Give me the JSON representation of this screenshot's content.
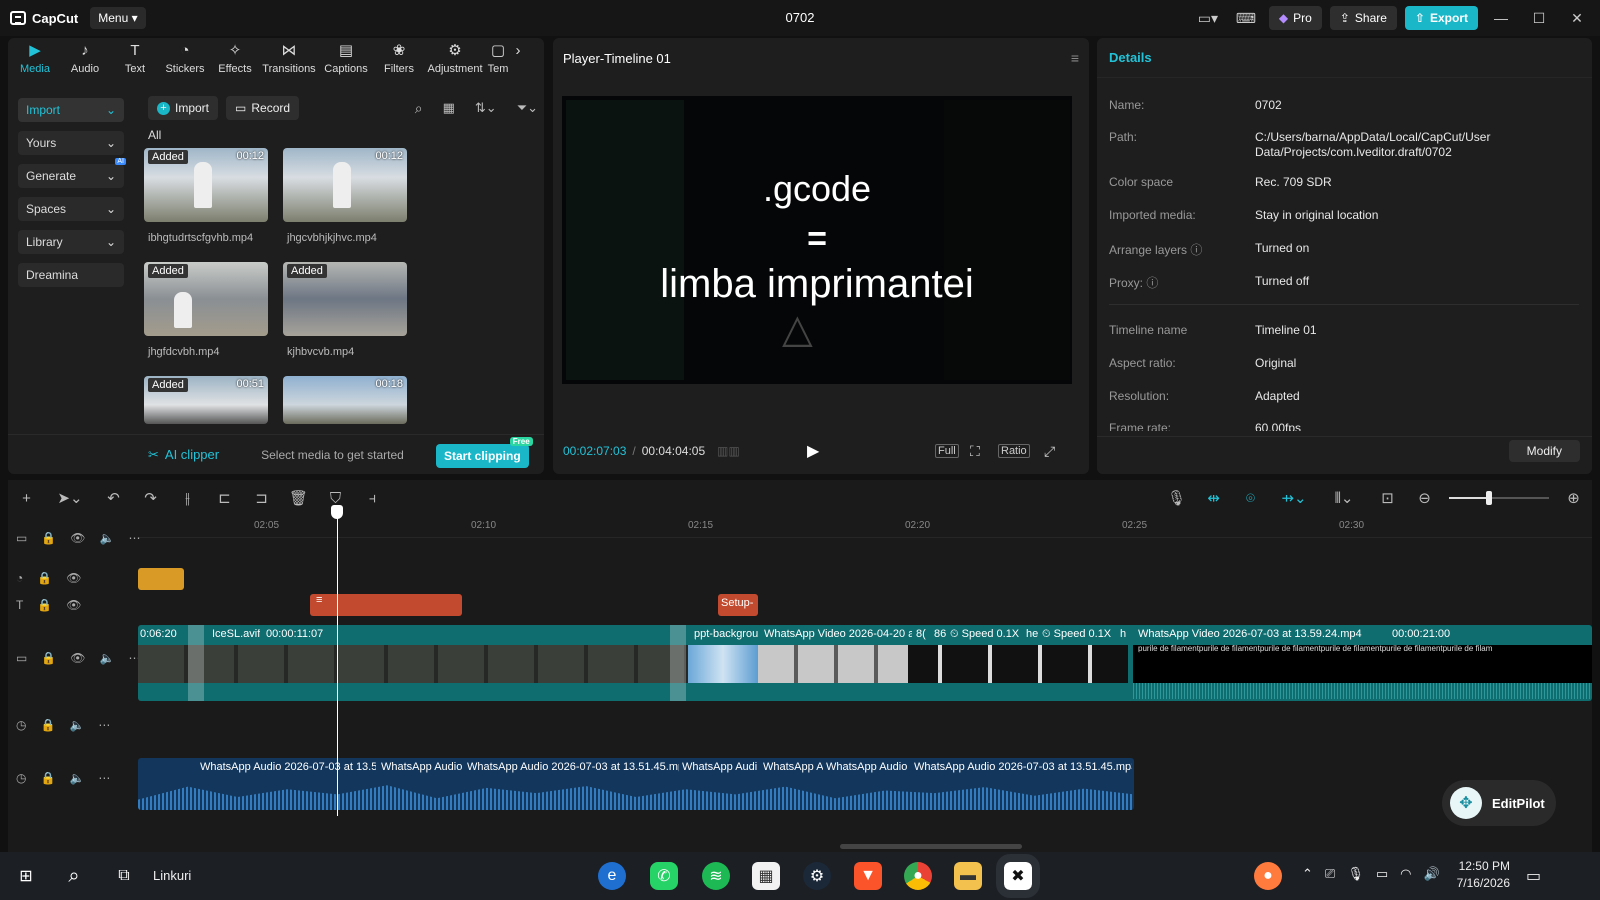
{
  "app": {
    "name": "CapCut",
    "menu": "Menu",
    "project_title": "0702"
  },
  "titlebar": {
    "pro_label": "Pro",
    "share_label": "Share",
    "export_label": "Export",
    "colors": {
      "accent": "#1ab7c9"
    }
  },
  "toolstrip": [
    {
      "label": "Media",
      "icon": "media-icon",
      "active": true
    },
    {
      "label": "Audio",
      "icon": "audio-icon"
    },
    {
      "label": "Text",
      "icon": "text-icon"
    },
    {
      "label": "Stickers",
      "icon": "sticker-icon"
    },
    {
      "label": "Effects",
      "icon": "effects-icon"
    },
    {
      "label": "Transitions",
      "icon": "transitions-icon"
    },
    {
      "label": "Captions",
      "icon": "captions-icon"
    },
    {
      "label": "Filters",
      "icon": "filters-icon"
    },
    {
      "label": "Adjustment",
      "icon": "adjustment-icon"
    },
    {
      "label": "Tem",
      "icon": "templates-icon"
    }
  ],
  "sidebar": [
    {
      "label": "Import",
      "active": true
    },
    {
      "label": "Yours"
    },
    {
      "label": "Generate",
      "badge": "AI"
    },
    {
      "label": "Spaces"
    },
    {
      "label": "Library"
    },
    {
      "label": "Dreamina"
    }
  ],
  "media": {
    "import_label": "Import",
    "record_label": "Record",
    "filter_all": "All",
    "items": [
      {
        "name": "ibhgtudrtscfgvhb.mp4",
        "added": "Added",
        "duration": "00:12"
      },
      {
        "name": "jhgcvbhjkjhvc.mp4",
        "added": "",
        "duration": "00:12"
      },
      {
        "name": "jhgfdcvbh.mp4",
        "added": "Added",
        "duration": ""
      },
      {
        "name": "kjhbvcvb.mp4",
        "added": "Added",
        "duration": ""
      },
      {
        "name": "",
        "added": "Added",
        "duration": "00:51"
      },
      {
        "name": "",
        "added": "",
        "duration": "00:18"
      }
    ]
  },
  "clipper": {
    "label": "AI clipper",
    "hint": "Select media to get started",
    "button": "Start clipping",
    "badge": "Free"
  },
  "player": {
    "title": "Player-Timeline 01",
    "overlay_line1": ".gcode",
    "overlay_line2": "=",
    "overlay_line3": "limba imprimantei",
    "current_time": "00:02:07:03",
    "total_time": "00:04:04:05",
    "full_label": "Full",
    "ratio_label": "Ratio"
  },
  "details": {
    "title": "Details",
    "rows": [
      {
        "key": "Name:",
        "value": "0702"
      },
      {
        "key": "Path:",
        "value": "C:/Users/barna/AppData/Local/CapCut/User Data/Projects/com.lveditor.draft/0702"
      },
      {
        "key": "Color space",
        "value": "Rec. 709 SDR"
      },
      {
        "key": "Imported media:",
        "value": "Stay in original location"
      },
      {
        "key": "Arrange layers",
        "value": "Turned on"
      },
      {
        "key": "Proxy:",
        "value": "Turned off"
      },
      {
        "key": "Timeline name",
        "value": "Timeline 01"
      },
      {
        "key": "Aspect ratio:",
        "value": "Original"
      },
      {
        "key": "Resolution:",
        "value": "Adapted"
      },
      {
        "key": "Frame rate:",
        "value": "60.00fps"
      }
    ],
    "modify_label": "Modify"
  },
  "timeline": {
    "ruler_ticks": [
      "02:05",
      "02:10",
      "02:15",
      "02:20",
      "02:25",
      "02:30"
    ],
    "text_clip": "Setup-",
    "video_clips": [
      {
        "label": "0:06:20"
      },
      {
        "label": "IceSL.avif",
        "duration": "00:00:11:07"
      },
      {
        "label": "ppt-backgrou"
      },
      {
        "label": "WhatsApp Video 2026-04-20 a"
      },
      {
        "label": "8("
      },
      {
        "label": "86"
      },
      {
        "label": "Speed 0.1X"
      },
      {
        "label": "he"
      },
      {
        "label": "Speed 0.1X"
      },
      {
        "label": "h"
      },
      {
        "label": "WhatsApp Video 2026-07-03 at 13.59.24.mp4",
        "duration": "00:00:21:00"
      }
    ],
    "overlay_text": "purile de filamentpurile de filamentpurile de filamentpurile de filamentpurile de filamentpurile de filam",
    "audio_clips": [
      {
        "label": "WhatsApp Audio 2026-07-03 at 13.51"
      },
      {
        "label": "WhatsApp Audio"
      },
      {
        "label": "WhatsApp Audio 2026-07-03 at 13.51.45.mp"
      },
      {
        "label": "WhatsApp Audi"
      },
      {
        "label": "WhatsApp A"
      },
      {
        "label": "WhatsApp Audio 2"
      },
      {
        "label": "WhatsApp Audio 2026-07-03 at 13.51.45.mp3"
      }
    ],
    "zoom_level": 0.4
  },
  "editpilot": {
    "label": "EditPilot"
  },
  "taskbar": {
    "search_text": "Linkuri",
    "time": "12:50 PM",
    "date": "7/16/2026"
  }
}
